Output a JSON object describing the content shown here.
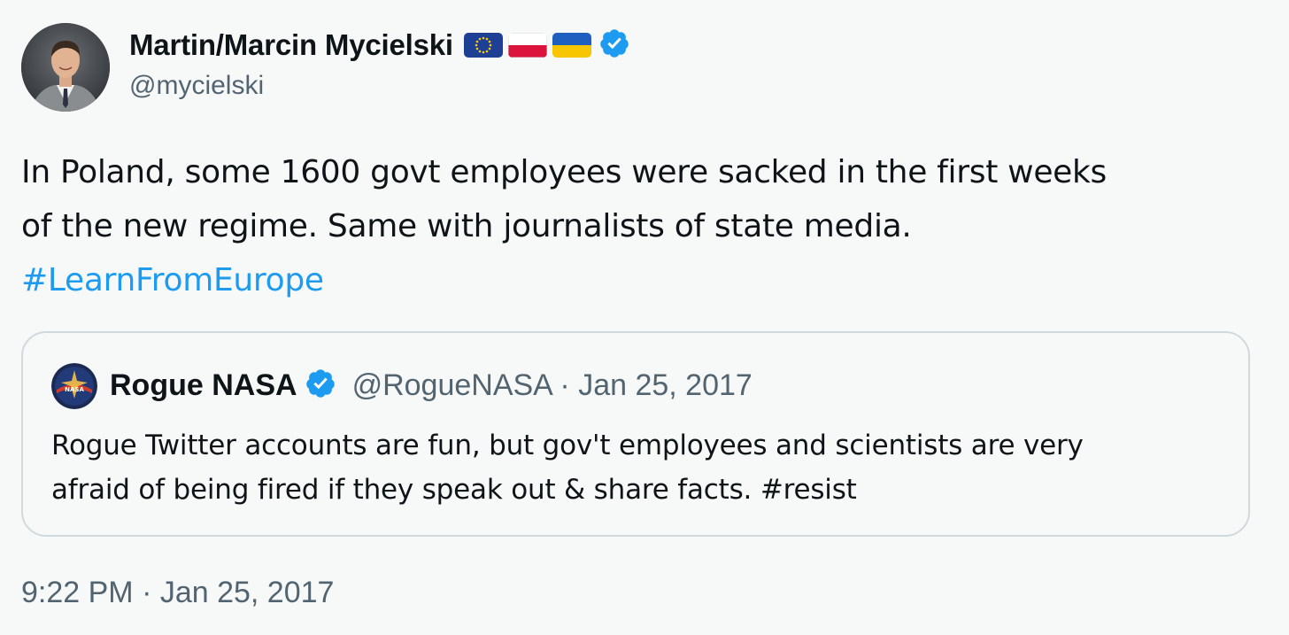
{
  "tweet": {
    "author_name": "Martin/Marcin Mycielski",
    "handle": "@mycielski",
    "badges": [
      "eu-flag-icon",
      "poland-flag-icon",
      "ukraine-flag-icon",
      "verified-badge-icon"
    ],
    "text_lines": [
      "In Poland, some 1600 govt employees were sacked in the first weeks",
      "of the new regime. Same with journalists of state media."
    ],
    "hashtag": "#LearnFromEurope",
    "timestamp": "9:22 PM · Jan 25, 2017"
  },
  "quoted_tweet": {
    "author_name": "Rogue NASA",
    "meta": "@RogueNASA · Jan 25, 2017",
    "avatar_text": "NASA",
    "text_lines": [
      "Rogue Twitter accounts are fun, but gov't employees and scientists are very",
      "afraid of being fired if they speak out & share facts. #resist"
    ]
  },
  "colors": {
    "background": "#f7f9f9",
    "text": "#0f1419",
    "secondary": "#536471",
    "link": "#1d9bf0",
    "verified": "#1d9bf0",
    "border": "#cfd9de"
  }
}
